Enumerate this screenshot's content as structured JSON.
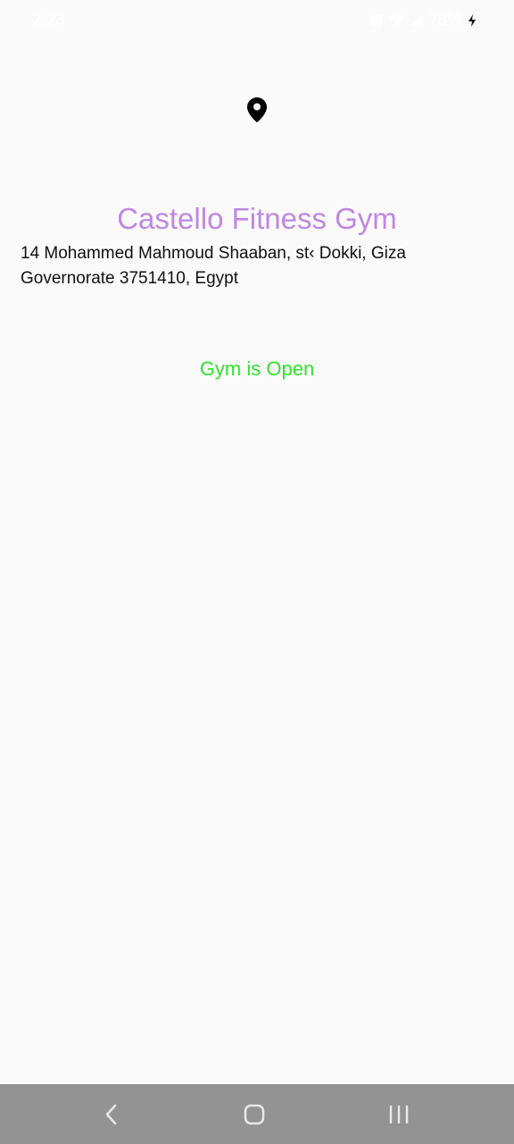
{
  "status_bar": {
    "time": "2:23",
    "battery": "78%"
  },
  "place": {
    "name": "Castello Fitness Gym",
    "address": "14 Mohammed Mahmoud Shaaban, st‹ Dokki, Giza Governorate 3751410, Egypt",
    "status": "Gym is Open"
  },
  "icons": {
    "pin": "location-pin-icon",
    "back": "back-icon",
    "home": "home-icon",
    "recents": "recents-icon"
  },
  "colors": {
    "title": "#c187e3",
    "open_status": "#2fe32a",
    "nav_bar": "#939393",
    "background": "#fafafa"
  }
}
